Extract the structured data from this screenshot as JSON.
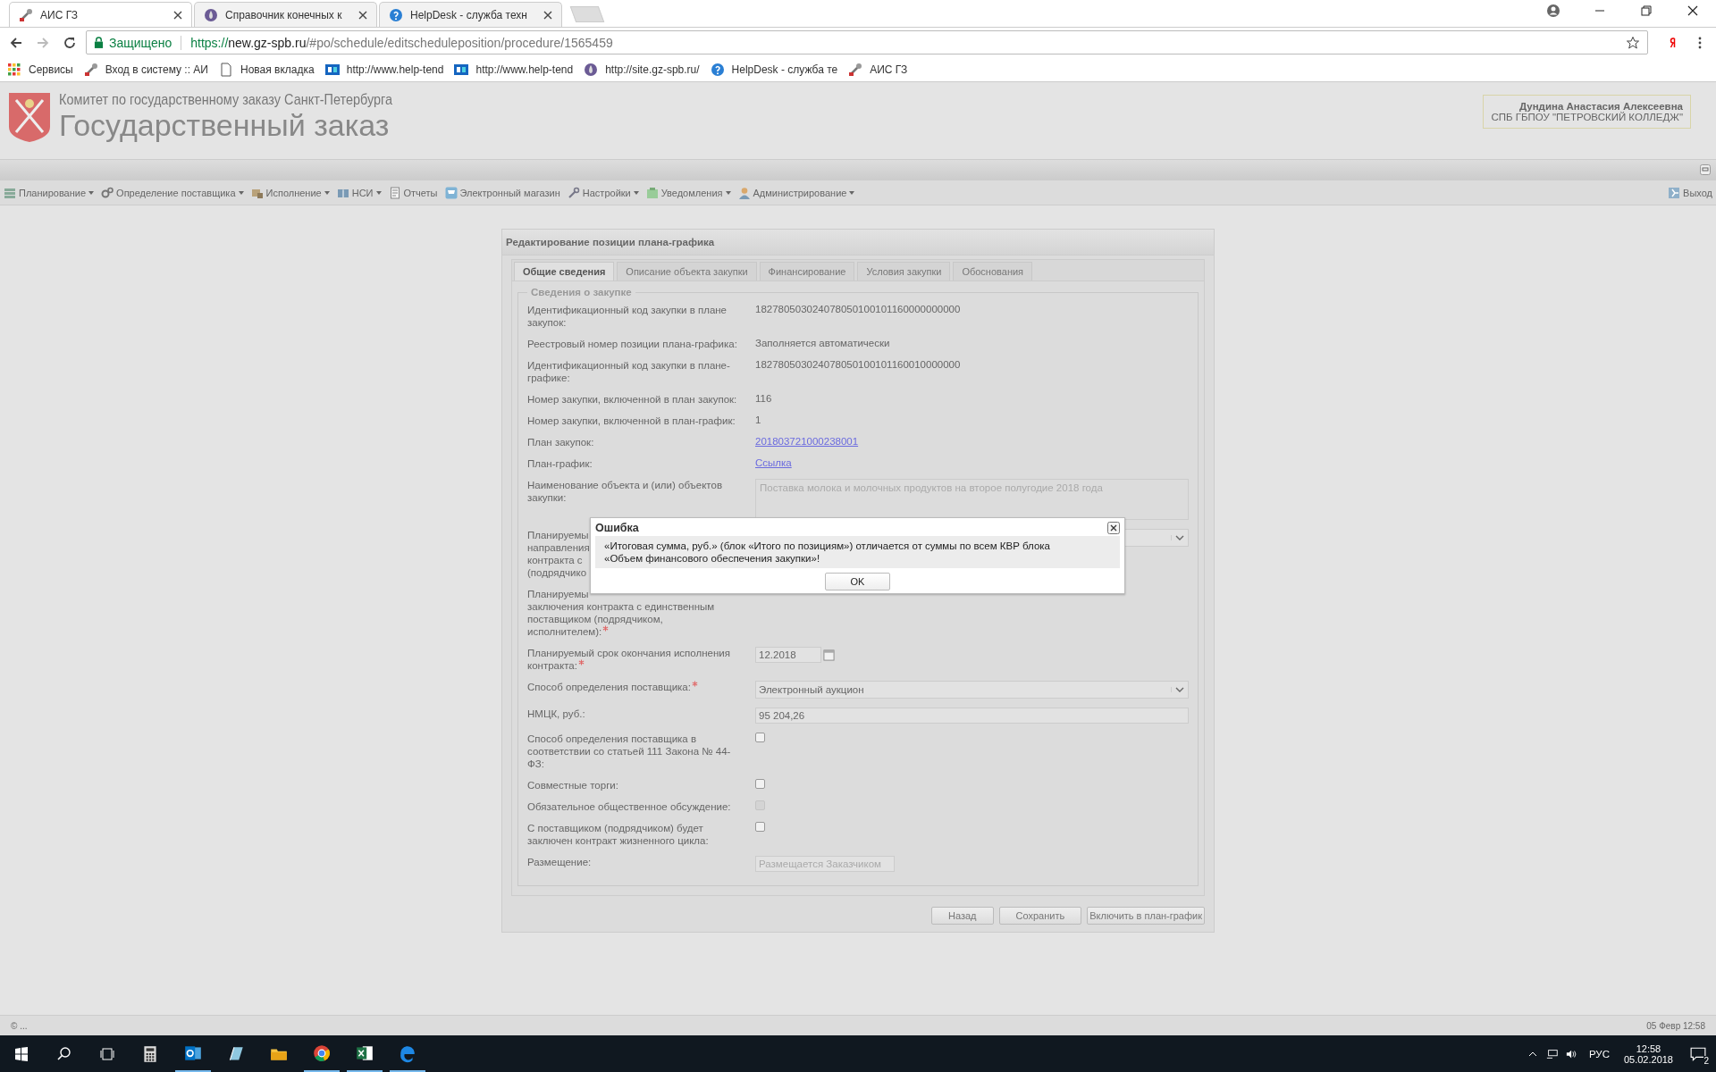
{
  "browser": {
    "tabs": [
      {
        "title": "АИС ГЗ",
        "selected": true
      },
      {
        "title": "Справочник конечных к",
        "selected": false
      },
      {
        "title": "HelpDesk - служба техн",
        "selected": false
      }
    ],
    "secure_label": "Защищено",
    "url_scheme": "https://",
    "url_host": "new.gz-spb.ru",
    "url_path": "/#po/schedule/editscheduleposition/procedure/1565459",
    "bookmarks": [
      "Сервисы",
      "Вход в систему :: АИ",
      "Новая вкладка",
      "http://www.help-tend",
      "http://www.help-tend",
      "http://site.gz-spb.ru/",
      "HelpDesk - служба те",
      "АИС ГЗ"
    ]
  },
  "header": {
    "org": "Комитет по государственному заказу Санкт-Петербурга",
    "title": "Государственный заказ",
    "user_name": "Дундина Анастасия Алексеевна",
    "user_org": "СПБ ГБПОУ \"ПЕТРОВСКИЙ КОЛЛЕДЖ\""
  },
  "menu": {
    "items": [
      {
        "label": "Планирование",
        "dropdown": true
      },
      {
        "label": "Определение поставщика",
        "dropdown": true
      },
      {
        "label": "Исполнение",
        "dropdown": true
      },
      {
        "label": "НСИ",
        "dropdown": true
      },
      {
        "label": "Отчеты",
        "dropdown": false
      },
      {
        "label": "Электронный магазин",
        "dropdown": false
      },
      {
        "label": "Настройки",
        "dropdown": true
      },
      {
        "label": "Уведомления",
        "dropdown": true
      },
      {
        "label": "Администрирование",
        "dropdown": true
      }
    ],
    "exit": "Выход"
  },
  "panel": {
    "title": "Редактирование позиции плана-графика",
    "tabs": [
      {
        "label": "Общие сведения",
        "selected": true
      },
      {
        "label": "Описание объекта закупки",
        "selected": false
      },
      {
        "label": "Финансирование",
        "selected": false
      },
      {
        "label": "Условия закупки",
        "selected": false
      },
      {
        "label": "Обоснования",
        "selected": false
      }
    ],
    "legend": "Сведения о закупке",
    "rows": [
      {
        "kind": "text",
        "label": [
          "Идентификационный код закупки в плане",
          "закупок:"
        ],
        "required": false,
        "value": "182780503024078050100101160000000000"
      },
      {
        "kind": "text",
        "label": [
          "Реестровый номер позиции плана-графика:"
        ],
        "required": false,
        "value": "Заполняется автоматически"
      },
      {
        "kind": "text",
        "label": [
          "Идентификационный код закупки в плане-",
          "графике:"
        ],
        "required": false,
        "value": "182780503024078050100101160010000000"
      },
      {
        "kind": "text",
        "label": [
          "Номер закупки, включенной в план закупок:"
        ],
        "required": false,
        "value": "116"
      },
      {
        "kind": "text",
        "label": [
          "Номер закупки, включенной в план-график:"
        ],
        "required": false,
        "value": "1"
      },
      {
        "kind": "link",
        "label": [
          "План закупок:"
        ],
        "required": false,
        "value": "201803721000238001"
      },
      {
        "kind": "link",
        "label": [
          "План-график:"
        ],
        "required": false,
        "value": "Ссылка"
      },
      {
        "kind": "textarea",
        "label": [
          "Наименование объекта и (или) объектов",
          "закупки:"
        ],
        "required": false,
        "value": "Поставка молока и молочных продуктов на второе полугодие 2018 года"
      },
      {
        "kind": "select",
        "label": [
          "Планируемы",
          "направления",
          "контракта с",
          "(подрядчико"
        ],
        "required": false
      },
      {
        "kind": "blank",
        "label": [
          "Планируемы",
          "заключения контракта с единственным",
          "поставщиком (подрядчиком,",
          "исполнителем):"
        ],
        "required": true
      },
      {
        "kind": "date",
        "label": [
          "Планируемый срок окончания исполнения",
          "контракта:"
        ],
        "required": true,
        "value": "12.2018"
      },
      {
        "kind": "select",
        "label": [
          "Способ определения поставщика:"
        ],
        "required": true,
        "value": "Электронный аукцион"
      },
      {
        "kind": "input",
        "label": [
          "НМЦК, руб.:"
        ],
        "required": false,
        "value": "95 204,26"
      },
      {
        "kind": "checkbox",
        "label": [
          "Способ определения поставщика в",
          "соответствии со статьей 111 Закона № 44-",
          "ФЗ:"
        ],
        "required": false,
        "checked": false,
        "disabled": false
      },
      {
        "kind": "checkbox",
        "label": [
          "Совместные торги:"
        ],
        "required": false,
        "checked": false,
        "disabled": false
      },
      {
        "kind": "checkbox",
        "label": [
          "Обязательное общественное обсуждение:"
        ],
        "required": false,
        "checked": false,
        "disabled": true
      },
      {
        "kind": "checkbox",
        "label": [
          "С поставщиком (подрядчиком) будет",
          "заключен контракт жизненного цикла:"
        ],
        "required": false,
        "checked": false,
        "disabled": false
      },
      {
        "kind": "readonly",
        "label": [
          "Размещение:"
        ],
        "required": false,
        "value": "Размещается Заказчиком"
      }
    ],
    "buttons": [
      "Назад",
      "Сохранить",
      "Включить в план-график"
    ]
  },
  "dialog": {
    "title": "Ошибка",
    "message_lines": [
      "«Итоговая сумма, руб.» (блок «Итого по позициям») отличается от суммы по всем КВР блока",
      "«Объем финансового обеспечения закупки»!"
    ],
    "button": "OK"
  },
  "status_bar": {
    "left": "© ...",
    "right": "05 Февр 12:58"
  },
  "taskbar": {
    "apps": [
      {
        "kind": "calculator",
        "running": false
      },
      {
        "kind": "outlook",
        "running": true
      },
      {
        "kind": "notes",
        "running": false
      },
      {
        "kind": "explorer",
        "running": false
      },
      {
        "kind": "chrome",
        "running": true
      },
      {
        "kind": "excel",
        "running": true
      },
      {
        "kind": "edge",
        "running": true
      }
    ],
    "language": "РУС",
    "time": "12:58",
    "date": "05.02.2018",
    "notifications": "2"
  }
}
